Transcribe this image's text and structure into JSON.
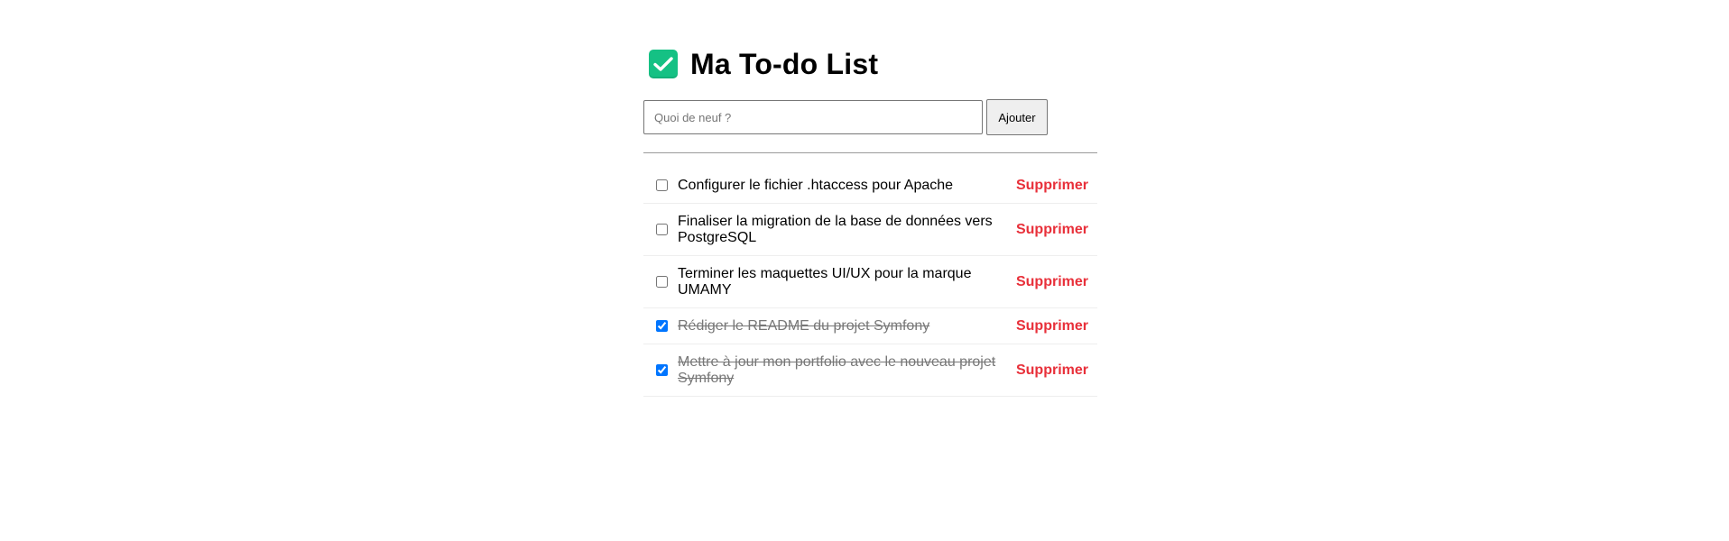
{
  "header": {
    "icon": "check-mark-button-icon",
    "title": "Ma To-do List"
  },
  "form": {
    "placeholder": "Quoi de neuf ?",
    "value": "",
    "add_label": "Ajouter"
  },
  "todos": [
    {
      "text": "Configurer le fichier .htaccess pour Apache",
      "done": false,
      "delete_label": "Supprimer"
    },
    {
      "text": "Finaliser la migration de la base de données vers PostgreSQL",
      "done": false,
      "delete_label": "Supprimer"
    },
    {
      "text": "Terminer les maquettes UI/UX pour la marque UMAMY",
      "done": false,
      "delete_label": "Supprimer"
    },
    {
      "text": "Rédiger le README du projet Symfony",
      "done": true,
      "delete_label": "Supprimer"
    },
    {
      "text": "Mettre à jour mon portfolio avec le nouveau projet Symfony",
      "done": true,
      "delete_label": "Supprimer"
    }
  ],
  "colors": {
    "icon_green": "#15c184",
    "delete_red": "#e8303a",
    "done_text": "#777777",
    "checkbox_blue": "#0075ff"
  }
}
